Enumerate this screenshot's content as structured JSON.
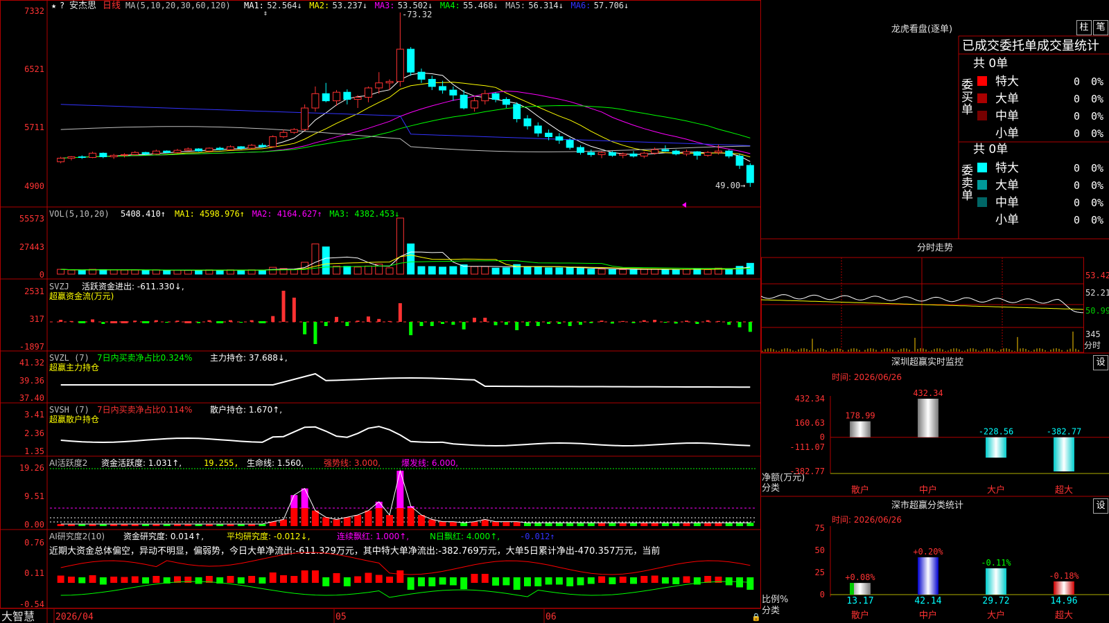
{
  "header": {
    "stock_name": "安杰思",
    "period": "日线",
    "ma_label": "MA(5,10,20,30,60,120)",
    "ma_values": [
      {
        "label": "MA1:",
        "value": "52.564↓",
        "color": "#ffffff"
      },
      {
        "label": "MA2:",
        "value": "53.237↓",
        "color": "#ffff00"
      },
      {
        "label": "MA3:",
        "value": "53.502↓",
        "color": "#ff00ff"
      },
      {
        "label": "MA4:",
        "value": "55.468↓",
        "color": "#00ff00"
      },
      {
        "label": "MA5:",
        "value": "56.314↓",
        "color": "#c0c0c0"
      },
      {
        "label": "MA6:",
        "value": "57.706↓",
        "color": "#3333ff"
      }
    ]
  },
  "price_axis": [
    "7332",
    "6521",
    "5711",
    "4900"
  ],
  "price_annotations": {
    "high": "73.32",
    "low": "49.00"
  },
  "vol": {
    "label": "VOL(5,10,20)",
    "value": "5408.410↑",
    "items": [
      {
        "label": "MA1:",
        "value": "4598.976↑",
        "color": "#ffff00"
      },
      {
        "label": "MA2:",
        "value": "4164.627↑",
        "color": "#ff00ff"
      },
      {
        "label": "MA3:",
        "value": "4382.453↓",
        "color": "#00ff00"
      }
    ],
    "axis": [
      "55573",
      "27443",
      "0"
    ]
  },
  "svzj": {
    "label": "SVZJ",
    "text": "活跃资金进出: -611.330↓,",
    "subtitle": "超赢资金流(万元)",
    "axis": [
      "2531",
      "317",
      "-1897"
    ]
  },
  "svzl": {
    "label": "SVZL (7)",
    "text1": "7日内买卖净占比0.324%",
    "text2": "主力持仓: 37.688↓,",
    "subtitle": "超赢主力持仓",
    "axis": [
      "41.32",
      "39.36",
      "37.40"
    ]
  },
  "svsh": {
    "label": "SVSH (7)",
    "text1": "7日内买卖净占比0.114%",
    "text2": "散户持仓: 1.670↑,",
    "subtitle": "超赢散户持仓",
    "axis": [
      "3.41",
      "2.36",
      "1.35"
    ]
  },
  "ai1": {
    "label": "AI活跃度2",
    "t1": "资金活跃度: 1.031↑,",
    "t2": "19.255,",
    "t3": "生命线: 1.560,",
    "t4": "强势线: 3.000,",
    "t5": "爆发线: 6.000,",
    "axis": [
      "19.26",
      "9.51",
      "0.00"
    ]
  },
  "ai2": {
    "label": "AI研究度2(10)",
    "t1": "资金研究度: 0.014↑,",
    "t2": "平均研究度: -0.012↓,",
    "t3": "连续飘红: 1.000↑,",
    "t4": "N日飘红: 4.000↑,",
    "t5": "-0.012↑",
    "summary": "近期大资金总体偏空，异动不明显，偏弱势，今日大单净流出:-611.329万元，其中特大单净流出:-382.769万元，大单5日累计净出-470.357万元，当前",
    "axis": [
      "0.76",
      "0.11",
      "-0.54"
    ]
  },
  "bottom": {
    "brand": "大智慧",
    "dates": [
      "2026/04",
      "05",
      "06"
    ]
  },
  "lhb": {
    "title": "龙虎看盘(逐单)",
    "btn1": "柱",
    "btn2": "笔",
    "subtitle": "已成交委托单成交量统计",
    "buy_label": "委买单",
    "sell_label": "委卖单",
    "buy_total": "共 0单",
    "sell_total": "共 0单",
    "buy_rows": [
      {
        "name": "特大",
        "count": "0",
        "pct": "0%",
        "color": "#ff0000"
      },
      {
        "name": "大单",
        "count": "0",
        "pct": "0%",
        "color": "#aa0000"
      },
      {
        "name": "中单",
        "count": "0",
        "pct": "0%",
        "color": "#770000"
      },
      {
        "name": "小单",
        "count": "0",
        "pct": "0%",
        "color": "#000000"
      }
    ],
    "sell_rows": [
      {
        "name": "特大",
        "count": "0",
        "pct": "0%",
        "color": "#00ffff"
      },
      {
        "name": "大单",
        "count": "0",
        "pct": "0%",
        "color": "#009999"
      },
      {
        "name": "中单",
        "count": "0",
        "pct": "0%",
        "color": "#006666"
      },
      {
        "name": "小单",
        "count": "0",
        "pct": "0%",
        "color": "#000000"
      }
    ]
  },
  "fenshi": {
    "title": "分时走势",
    "axis": [
      "53.42",
      "52.21",
      "50.99"
    ],
    "vol_label": "345",
    "vol_unit": "分时"
  },
  "monitor": {
    "title": "深圳超赢实时监控",
    "btn": "设",
    "time": "时间: 2026/06/26",
    "axis": [
      "432.34",
      "160.63",
      "0",
      "-111.07",
      "-382.77"
    ],
    "ylabel1": "净额(万元)",
    "ylabel2": "分类",
    "bars": [
      {
        "name": "散户",
        "value": 178.99,
        "label": "178.99"
      },
      {
        "name": "中户",
        "value": 432.34,
        "label": "432.34"
      },
      {
        "name": "大户",
        "value": -228.56,
        "label": "-228.56"
      },
      {
        "name": "超大",
        "value": -382.77,
        "label": "-382.77"
      }
    ]
  },
  "classify": {
    "title": "深市超赢分类统计",
    "btn": "设",
    "time": "时间: 2026/06/26",
    "axis": [
      "75",
      "50",
      "25",
      "0"
    ],
    "ylabel1": "比例%",
    "ylabel2": "分类",
    "bars": [
      {
        "name": "散户",
        "value": 13.17,
        "label": "13.17",
        "change": "+0.08%"
      },
      {
        "name": "中户",
        "value": 42.14,
        "label": "42.14",
        "change": "+0.20%"
      },
      {
        "name": "大户",
        "value": 29.72,
        "label": "29.72",
        "change": "-0.11%"
      },
      {
        "name": "超大",
        "value": 14.96,
        "label": "14.96",
        "change": "-0.18%"
      }
    ]
  },
  "chart_data": {
    "type": "candlestick",
    "title": "安杰思 日线",
    "ylim": [
      49.0,
      73.32
    ],
    "candles": [
      [
        52.5,
        53.2,
        52.3,
        53.0
      ],
      [
        53.0,
        53.3,
        52.7,
        53.2
      ],
      [
        53.2,
        53.4,
        52.9,
        53.1
      ],
      [
        53.1,
        53.9,
        53.0,
        53.7
      ],
      [
        53.7,
        53.8,
        53.0,
        53.2
      ],
      [
        53.2,
        53.6,
        52.9,
        53.4
      ],
      [
        53.4,
        53.7,
        53.1,
        53.5
      ],
      [
        53.5,
        54.0,
        53.4,
        53.8
      ],
      [
        53.8,
        53.9,
        53.4,
        53.6
      ],
      [
        53.6,
        54.2,
        53.5,
        54.0
      ],
      [
        54.0,
        54.1,
        53.7,
        53.8
      ],
      [
        53.8,
        54.3,
        53.7,
        54.1
      ],
      [
        54.1,
        54.5,
        54.0,
        54.3
      ],
      [
        54.3,
        54.4,
        53.9,
        54.0
      ],
      [
        54.0,
        54.5,
        53.8,
        54.4
      ],
      [
        54.4,
        54.6,
        54.1,
        54.2
      ],
      [
        54.2,
        54.8,
        54.1,
        54.6
      ],
      [
        54.6,
        54.7,
        54.2,
        54.4
      ],
      [
        54.4,
        55.0,
        54.3,
        54.8
      ],
      [
        54.8,
        55.1,
        54.5,
        54.6
      ],
      [
        54.6,
        56.2,
        54.5,
        56.0
      ],
      [
        56.0,
        57.0,
        55.8,
        56.6
      ],
      [
        56.6,
        57.2,
        56.4,
        57.0
      ],
      [
        57.0,
        60.5,
        56.8,
        60.0
      ],
      [
        60.0,
        63.0,
        59.5,
        62.0
      ],
      [
        62.0,
        63.5,
        60.8,
        61.0
      ],
      [
        61.0,
        62.5,
        60.3,
        62.2
      ],
      [
        62.2,
        62.6,
        60.5,
        61.2
      ],
      [
        61.2,
        61.8,
        60.0,
        61.5
      ],
      [
        61.5,
        63.0,
        60.8,
        62.8
      ],
      [
        62.8,
        65.0,
        62.0,
        63.5
      ],
      [
        63.5,
        64.0,
        62.5,
        63.7
      ],
      [
        63.7,
        73.32,
        63.0,
        68.2
      ],
      [
        68.2,
        68.5,
        64.5,
        65.0
      ],
      [
        65.0,
        65.5,
        63.5,
        64.0
      ],
      [
        64.0,
        64.5,
        62.5,
        63.0
      ],
      [
        63.0,
        63.8,
        62.0,
        62.5
      ],
      [
        62.5,
        63.0,
        61.0,
        61.8
      ],
      [
        61.8,
        62.5,
        59.8,
        60.0
      ],
      [
        60.0,
        61.5,
        59.5,
        61.0
      ],
      [
        61.0,
        62.5,
        60.5,
        62.0
      ],
      [
        62.0,
        62.2,
        60.8,
        61.2
      ],
      [
        61.2,
        61.5,
        60.0,
        60.5
      ],
      [
        60.5,
        60.8,
        58.0,
        58.5
      ],
      [
        58.5,
        59.0,
        57.0,
        57.5
      ],
      [
        57.5,
        58.0,
        56.0,
        56.5
      ],
      [
        56.5,
        57.0,
        55.5,
        56.0
      ],
      [
        56.0,
        56.5,
        55.0,
        55.5
      ],
      [
        55.5,
        55.8,
        54.2,
        54.5
      ],
      [
        54.5,
        54.8,
        53.5,
        53.8
      ],
      [
        53.8,
        54.2,
        53.2,
        53.5
      ],
      [
        53.5,
        54.0,
        53.0,
        53.8
      ],
      [
        53.8,
        54.0,
        53.2,
        53.4
      ],
      [
        53.4,
        53.8,
        53.0,
        53.6
      ],
      [
        53.6,
        54.0,
        53.1,
        53.3
      ],
      [
        53.3,
        53.9,
        53.0,
        53.7
      ],
      [
        53.7,
        54.5,
        53.5,
        54.2
      ],
      [
        54.2,
        54.8,
        53.9,
        54.0
      ],
      [
        54.0,
        54.2,
        53.4,
        53.6
      ],
      [
        53.6,
        54.2,
        53.3,
        53.9
      ],
      [
        53.9,
        54.0,
        52.8,
        53.4
      ],
      [
        53.4,
        54.0,
        53.2,
        53.8
      ],
      [
        53.8,
        54.9,
        53.5,
        54.0
      ],
      [
        54.0,
        54.2,
        53.0,
        53.3
      ],
      [
        53.3,
        53.6,
        51.5,
        52.0
      ],
      [
        52.0,
        52.3,
        49.0,
        49.6
      ]
    ]
  }
}
